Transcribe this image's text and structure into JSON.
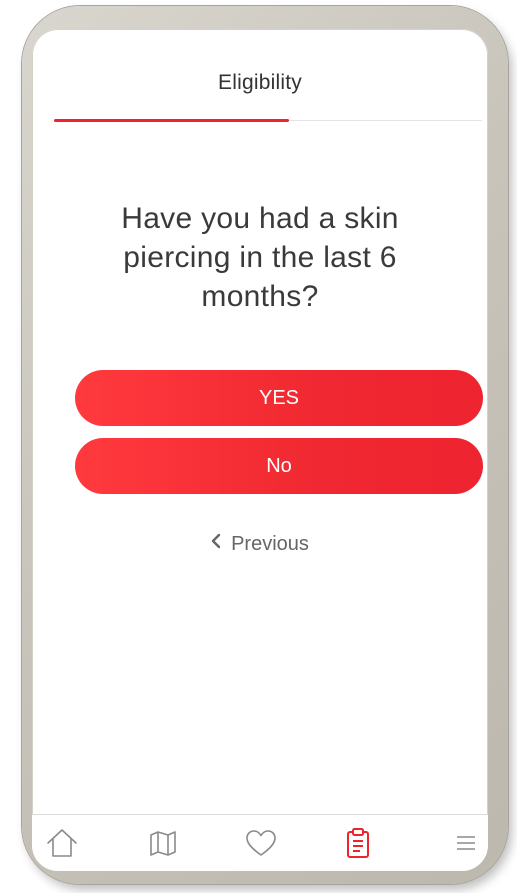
{
  "header": {
    "title": "Eligibility",
    "progress": 0.55
  },
  "question": {
    "text": "Have you had a skin piercing in the last 6 months?"
  },
  "answers": {
    "yes_label": "YES",
    "no_label": "No"
  },
  "navigation": {
    "previous_label": "Previous"
  },
  "tabbar": {
    "items": [
      {
        "icon": "home-icon",
        "active": false
      },
      {
        "icon": "map-icon",
        "active": false
      },
      {
        "icon": "heart-icon",
        "active": false
      },
      {
        "icon": "clipboard-icon",
        "active": true
      },
      {
        "icon": "menu-icon",
        "active": false
      }
    ]
  },
  "colors": {
    "accent": "#f0232d",
    "inactive_icon": "#8a8a8a"
  }
}
